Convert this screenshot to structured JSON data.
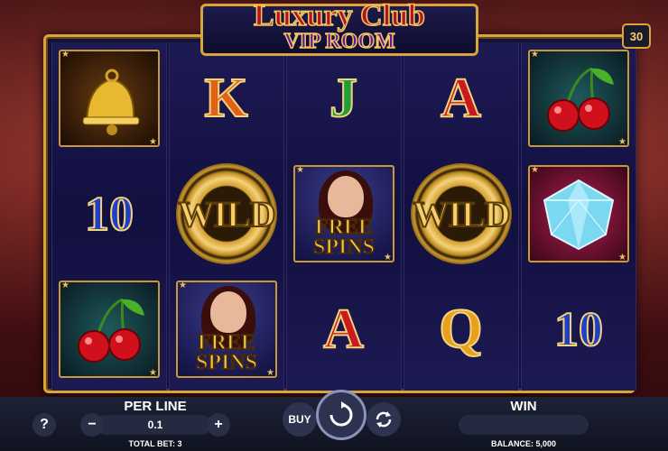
{
  "game": {
    "title_line1": "Luxury Club",
    "title_line2": "VIP ROOM",
    "paylines": "30"
  },
  "reels": [
    [
      {
        "symbol": "bell",
        "label": ""
      },
      {
        "symbol": "ten",
        "label": "10"
      },
      {
        "symbol": "cherry",
        "label": ""
      }
    ],
    [
      {
        "symbol": "king",
        "label": "K"
      },
      {
        "symbol": "wild",
        "label": "WILD"
      },
      {
        "symbol": "free-spins",
        "label": "FREE SPINS"
      }
    ],
    [
      {
        "symbol": "jack",
        "label": "J"
      },
      {
        "symbol": "free-spins",
        "label": "FREE SPINS"
      },
      {
        "symbol": "ace",
        "label": "A"
      }
    ],
    [
      {
        "symbol": "ace",
        "label": "A"
      },
      {
        "symbol": "wild",
        "label": "WILD"
      },
      {
        "symbol": "queen",
        "label": "Q"
      }
    ],
    [
      {
        "symbol": "cherry",
        "label": ""
      },
      {
        "symbol": "diamond",
        "label": ""
      },
      {
        "symbol": "ten",
        "label": "10"
      }
    ]
  ],
  "controls": {
    "help_label": "?",
    "per_line_label": "PER LINE",
    "per_line_value": "0.1",
    "minus_label": "−",
    "plus_label": "+",
    "total_bet_label": "TOTAL BET: 3",
    "buy_label": "BUY",
    "win_label": "WIN",
    "balance_label": "BALANCE: 5,000"
  },
  "colors": {
    "gold": "#d9a43a",
    "reel_bg": "#14123a",
    "letter_k": "#e0621a",
    "letter_j": "#1f9e3a",
    "letter_a": "#c81a20",
    "letter_q": "#e8a020",
    "number_10": "#1f3fc8"
  }
}
